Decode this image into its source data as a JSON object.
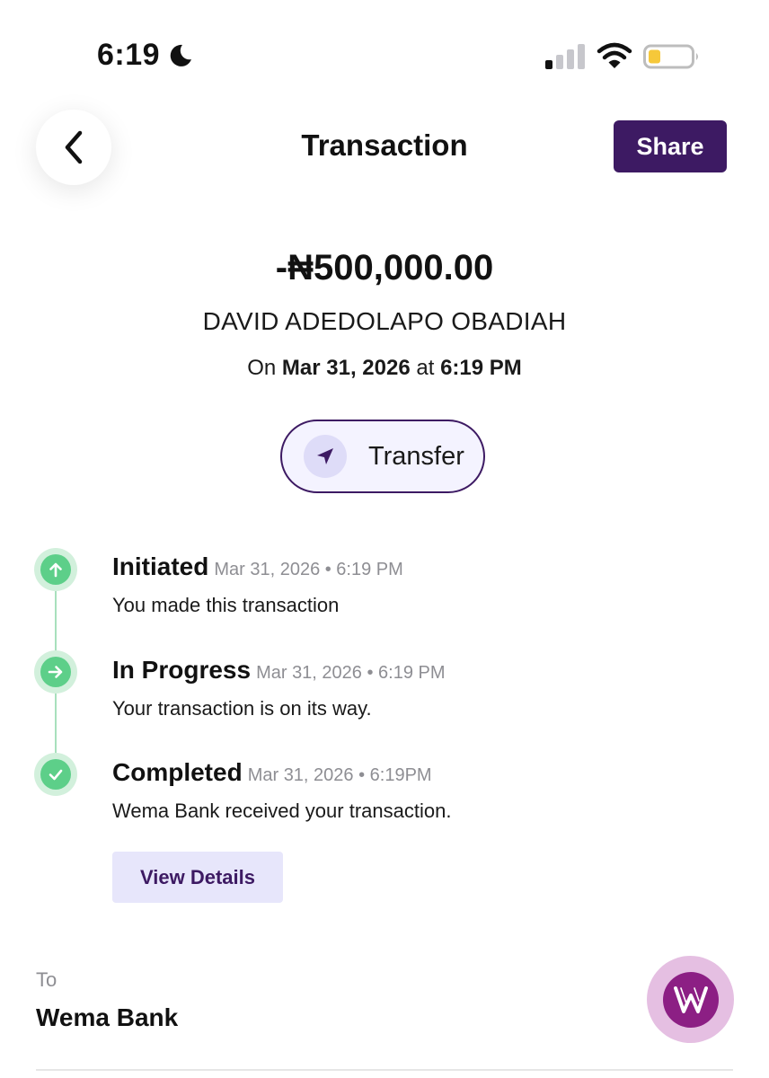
{
  "status_bar": {
    "time": "6:19",
    "icons": [
      "moon-icon",
      "cellular-signal-icon",
      "wifi-icon",
      "battery-icon"
    ],
    "battery_color": "#f6c83a"
  },
  "header": {
    "back_icon": "chevron-left-icon",
    "title": "Transaction",
    "share_label": "Share"
  },
  "summary": {
    "amount": "-₦500,000.00",
    "recipient_name": "DAVID ADEDOLAPO OBADIAH",
    "date_prefix": "On",
    "date": "Mar 31, 2026",
    "date_joiner": "at",
    "time": "6:19 PM"
  },
  "transaction_type": {
    "icon": "send-arrow-icon",
    "label": "Transfer"
  },
  "timeline": [
    {
      "title": "Initiated",
      "timestamp": "Mar 31, 2026 • 6:19 PM",
      "description": "You made this transaction",
      "icon": "arrow-up-icon"
    },
    {
      "title": "In Progress",
      "timestamp": "Mar 31, 2026 • 6:19 PM",
      "description": "Your transaction is on its way.",
      "icon": "arrow-right-icon"
    },
    {
      "title": "Completed",
      "timestamp": "Mar 31, 2026 • 6:19PM",
      "description": "Wema Bank received your transaction.",
      "icon": "check-icon"
    }
  ],
  "view_details_label": "View Details",
  "destination": {
    "label": "To",
    "bank_name": "Wema Bank",
    "logo_icon": "wema-bank-logo-icon"
  },
  "colors": {
    "brand_purple": "#3d1a63",
    "success_green": "#5dcf89",
    "timeline_halo": "#d2f0dc",
    "secondary_text": "#8e8e93",
    "wema_purple": "#8c1f84"
  }
}
